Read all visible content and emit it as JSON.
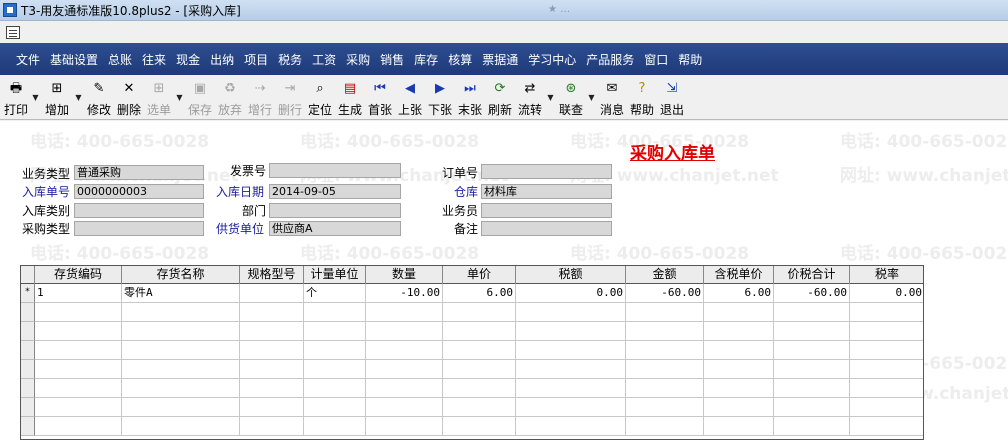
{
  "window": {
    "title": "T3-用友通标准版10.8plus2 - [采购入库]",
    "ghost_text": "★ …"
  },
  "menu": [
    "文件",
    "基础设置",
    "总账",
    "往来",
    "现金",
    "出纳",
    "项目",
    "税务",
    "工资",
    "采购",
    "销售",
    "库存",
    "核算",
    "票据通",
    "学习中心",
    "产品服务",
    "窗口",
    "帮助"
  ],
  "toolbar": {
    "print": "打印",
    "add": "增加",
    "modify": "修改",
    "delete": "删除",
    "select": "选单",
    "save": "保存",
    "abandon": "放弃",
    "add_row": "增行",
    "delete_row": "删行",
    "locate": "定位",
    "generate": "生成",
    "first": "首张",
    "prev": "上张",
    "next": "下张",
    "last": "末张",
    "refresh": "刷新",
    "flow": "流转",
    "linked_query": "联查",
    "message": "消息",
    "help": "帮助",
    "exit": "退出"
  },
  "watermark": {
    "phone": "电话: 400-665-0028",
    "site": "网址: www.chanjet.net"
  },
  "form": {
    "title": "采购入库单",
    "labels": {
      "business_type": "业务类型",
      "invoice_no": "发票号",
      "order_no": "订单号",
      "receipt_no": "入库单号",
      "receipt_date": "入库日期",
      "warehouse": "仓库",
      "receipt_category": "入库类别",
      "department": "部门",
      "salesperson": "业务员",
      "purchase_type": "采购类型",
      "supplier": "供货单位",
      "remark": "备注"
    },
    "values": {
      "business_type": "普通采购",
      "invoice_no": "",
      "order_no": "",
      "receipt_no": "0000000003",
      "receipt_date": "2014-09-05",
      "warehouse": "材料库",
      "receipt_category": "",
      "department": "",
      "salesperson": "",
      "purchase_type": "",
      "supplier": "供应商A",
      "remark": ""
    }
  },
  "grid": {
    "columns": [
      "存货编码",
      "存货名称",
      "规格型号",
      "计量单位",
      "数量",
      "单价",
      "税额",
      "金额",
      "含税单价",
      "价税合计",
      "税率"
    ],
    "rows": [
      {
        "marker": "*",
        "cells": [
          "1",
          "零件A",
          "",
          "个",
          "-10.00",
          "6.00",
          "0.00",
          "-60.00",
          "6.00",
          "-60.00",
          "0.00"
        ]
      }
    ]
  },
  "colors": {
    "menubar": "#2d4e92",
    "title_red": "#e00000",
    "label_blue": "#1d20a0"
  }
}
